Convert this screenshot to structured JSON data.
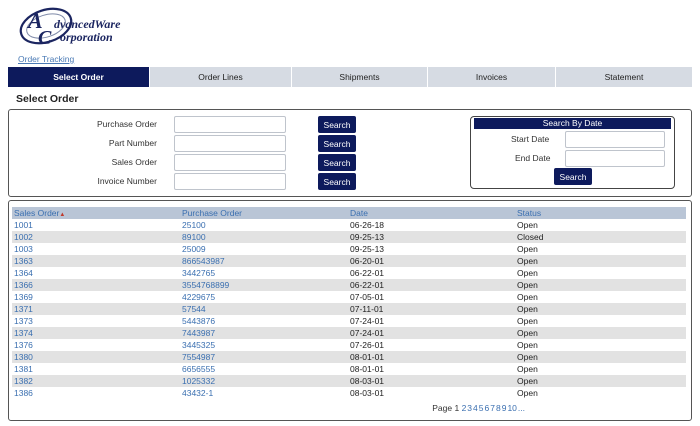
{
  "logo": {
    "line1": "dvancedWare",
    "line2": "orporation",
    "initial1": "A",
    "initial2": "C"
  },
  "breadcrumb": "Order Tracking",
  "tabs": [
    {
      "label": "Select Order",
      "active": true
    },
    {
      "label": "Order Lines",
      "active": false
    },
    {
      "label": "Shipments",
      "active": false
    },
    {
      "label": "Invoices",
      "active": false
    },
    {
      "label": "Statement",
      "active": false
    }
  ],
  "page_title": "Select Order",
  "search": {
    "fields": [
      {
        "label": "Purchase Order",
        "value": "",
        "button": "Search"
      },
      {
        "label": "Part Number",
        "value": "",
        "button": "Search"
      },
      {
        "label": "Sales Order",
        "value": "",
        "button": "Search"
      },
      {
        "label": "Invoice Number",
        "value": "",
        "button": "Search"
      }
    ],
    "by_date": {
      "title": "Search By Date",
      "start_label": "Start Date",
      "end_label": "End Date",
      "start_value": "",
      "end_value": "",
      "button": "Search"
    }
  },
  "grid": {
    "columns": [
      "Sales Order",
      "Purchase Order",
      "Date",
      "Status"
    ],
    "sort_column": "Sales Order",
    "rows": [
      [
        "1001",
        "25100",
        "06-26-18",
        "Open"
      ],
      [
        "1002",
        "89100",
        "09-25-13",
        "Closed"
      ],
      [
        "1003",
        "25009",
        "09-25-13",
        "Open"
      ],
      [
        "1363",
        "866543987",
        "06-20-01",
        "Open"
      ],
      [
        "1364",
        "3442765",
        "06-22-01",
        "Open"
      ],
      [
        "1366",
        "3554768899",
        "06-22-01",
        "Open"
      ],
      [
        "1369",
        "4229675",
        "07-05-01",
        "Open"
      ],
      [
        "1371",
        "57544",
        "07-11-01",
        "Open"
      ],
      [
        "1373",
        "5443876",
        "07-24-01",
        "Open"
      ],
      [
        "1374",
        "7443987",
        "07-24-01",
        "Open"
      ],
      [
        "1376",
        "3445325",
        "07-26-01",
        "Open"
      ],
      [
        "1380",
        "7554987",
        "08-01-01",
        "Open"
      ],
      [
        "1381",
        "6656555",
        "08-01-01",
        "Open"
      ],
      [
        "1382",
        "1025332",
        "08-03-01",
        "Open"
      ],
      [
        "1386",
        "43432-1",
        "08-03-01",
        "Open"
      ]
    ]
  },
  "pager": {
    "prefix": "Page",
    "current": "1",
    "pages": [
      "2",
      "3",
      "4",
      "5",
      "6",
      "7",
      "8",
      "9",
      "10",
      "..."
    ]
  },
  "colors": {
    "accent": "#0d1a5c",
    "link": "#3a6fb0",
    "tab_bg": "#d6dbe3",
    "row_alt": "#e2e2e2",
    "header_bg": "#b9c5d6"
  }
}
